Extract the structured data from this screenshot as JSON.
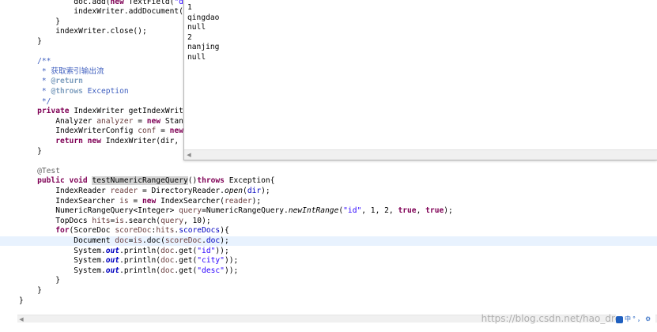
{
  "editor": {
    "code_lines": [
      [
        {
          "t": "            doc.add("
        },
        {
          "t": "new",
          "c": "kw"
        },
        {
          "t": " TextField("
        },
        {
          "t": "\"de",
          "c": "str"
        }
      ],
      [
        {
          "t": "            indexWriter.addDocument(c"
        }
      ],
      [
        {
          "t": "        }"
        }
      ],
      [
        {
          "t": "        indexWriter.close();"
        }
      ],
      [
        {
          "t": "    }"
        }
      ],
      [
        {
          "t": ""
        }
      ],
      [
        {
          "t": "    /**",
          "c": "jd"
        }
      ],
      [
        {
          "t": "     * 获取索引输出流",
          "c": "jd"
        }
      ],
      [
        {
          "t": "     * ",
          "c": "jd"
        },
        {
          "t": "@return",
          "c": "jdtag"
        }
      ],
      [
        {
          "t": "     * ",
          "c": "jd"
        },
        {
          "t": "@throws",
          "c": "jdtag"
        },
        {
          "t": " Exception",
          "c": "jd"
        }
      ],
      [
        {
          "t": "     */",
          "c": "jd"
        }
      ],
      [
        {
          "t": "    "
        },
        {
          "t": "private",
          "c": "kw"
        },
        {
          "t": " IndexWriter getIndexWrite"
        }
      ],
      [
        {
          "t": "        Analyzer "
        },
        {
          "t": "analyzer",
          "c": "var"
        },
        {
          "t": " = "
        },
        {
          "t": "new",
          "c": "kw"
        },
        {
          "t": " Stanc"
        }
      ],
      [
        {
          "t": "        IndexWriterConfig "
        },
        {
          "t": "conf",
          "c": "var"
        },
        {
          "t": " = "
        },
        {
          "t": "new",
          "c": "kw"
        }
      ],
      [
        {
          "t": "        "
        },
        {
          "t": "return",
          "c": "kw"
        },
        {
          "t": " "
        },
        {
          "t": "new",
          "c": "kw"
        },
        {
          "t": " IndexWriter(dir, c"
        }
      ],
      [
        {
          "t": "    }"
        }
      ],
      [
        {
          "t": ""
        }
      ],
      [
        {
          "t": "    @Test",
          "c": "ann"
        }
      ],
      [
        {
          "t": "    "
        },
        {
          "t": "public",
          "c": "kw"
        },
        {
          "t": " "
        },
        {
          "t": "void",
          "c": "kw"
        },
        {
          "t": " "
        },
        {
          "t": "testNumericRangeQuery",
          "c": "mark"
        },
        {
          "t": "()"
        },
        {
          "t": "throws",
          "c": "kw"
        },
        {
          "t": " Exception{"
        }
      ],
      [
        {
          "t": "        IndexReader "
        },
        {
          "t": "reader",
          "c": "var"
        },
        {
          "t": " = DirectoryReader."
        },
        {
          "t": "open",
          "c": "it"
        },
        {
          "t": "("
        },
        {
          "t": "dir",
          "c": "fld"
        },
        {
          "t": ");"
        }
      ],
      [
        {
          "t": "        IndexSearcher "
        },
        {
          "t": "is",
          "c": "var"
        },
        {
          "t": " = "
        },
        {
          "t": "new",
          "c": "kw"
        },
        {
          "t": " IndexSearcher("
        },
        {
          "t": "reader",
          "c": "var"
        },
        {
          "t": ");"
        }
      ],
      [
        {
          "t": "        NumericRangeQuery<Integer> "
        },
        {
          "t": "query",
          "c": "var"
        },
        {
          "t": "=NumericRangeQuery."
        },
        {
          "t": "newIntRange",
          "c": "it"
        },
        {
          "t": "("
        },
        {
          "t": "\"id\"",
          "c": "str"
        },
        {
          "t": ", 1, 2, "
        },
        {
          "t": "true",
          "c": "kw"
        },
        {
          "t": ", "
        },
        {
          "t": "true",
          "c": "kw"
        },
        {
          "t": ");"
        }
      ],
      [
        {
          "t": "        TopDocs "
        },
        {
          "t": "hits",
          "c": "var"
        },
        {
          "t": "="
        },
        {
          "t": "is",
          "c": "var"
        },
        {
          "t": ".search("
        },
        {
          "t": "query",
          "c": "var"
        },
        {
          "t": ", 10);"
        }
      ],
      [
        {
          "t": "        "
        },
        {
          "t": "for",
          "c": "kw"
        },
        {
          "t": "(ScoreDoc "
        },
        {
          "t": "scoreDoc",
          "c": "var"
        },
        {
          "t": ":"
        },
        {
          "t": "hits",
          "c": "var"
        },
        {
          "t": "."
        },
        {
          "t": "scoreDocs",
          "c": "fld"
        },
        {
          "t": "){"
        }
      ],
      [
        {
          "t": "            Document "
        },
        {
          "t": "doc",
          "c": "var"
        },
        {
          "t": "="
        },
        {
          "t": "is",
          "c": "var"
        },
        {
          "t": ".doc("
        },
        {
          "t": "scoreDoc",
          "c": "var"
        },
        {
          "t": "."
        },
        {
          "t": "doc",
          "c": "fld"
        },
        {
          "t": ");"
        }
      ],
      [
        {
          "t": "            System."
        },
        {
          "t": "out",
          "c": "sfld"
        },
        {
          "t": ".println("
        },
        {
          "t": "doc",
          "c": "var"
        },
        {
          "t": ".get("
        },
        {
          "t": "\"id\"",
          "c": "str"
        },
        {
          "t": "));"
        }
      ],
      [
        {
          "t": "            System."
        },
        {
          "t": "out",
          "c": "sfld"
        },
        {
          "t": ".println("
        },
        {
          "t": "doc",
          "c": "var"
        },
        {
          "t": ".get("
        },
        {
          "t": "\"city\"",
          "c": "str"
        },
        {
          "t": "));"
        }
      ],
      [
        {
          "t": "            System."
        },
        {
          "t": "out",
          "c": "sfld"
        },
        {
          "t": ".println("
        },
        {
          "t": "doc",
          "c": "var"
        },
        {
          "t": ".get("
        },
        {
          "t": "\"desc\"",
          "c": "str"
        },
        {
          "t": "));"
        }
      ],
      [
        {
          "t": "        }"
        }
      ],
      [
        {
          "t": "    }"
        }
      ],
      [
        {
          "t": "}"
        }
      ]
    ]
  },
  "console": {
    "lines": [
      "1",
      "qingdao",
      "null",
      "2",
      "nanjing",
      "null"
    ]
  },
  "watermark": "https://blog.csdn.net/hao_dre",
  "ime": {
    "lang": "中",
    "mode": "°",
    "punct": "，",
    "tool": "⚙"
  },
  "colors": {
    "keyword": "#7f0055",
    "string": "#2a00ff",
    "field": "#0000c0",
    "javadoc": "#3f5fbf",
    "annotation": "#646464",
    "current_line": "#e8f2fe"
  }
}
